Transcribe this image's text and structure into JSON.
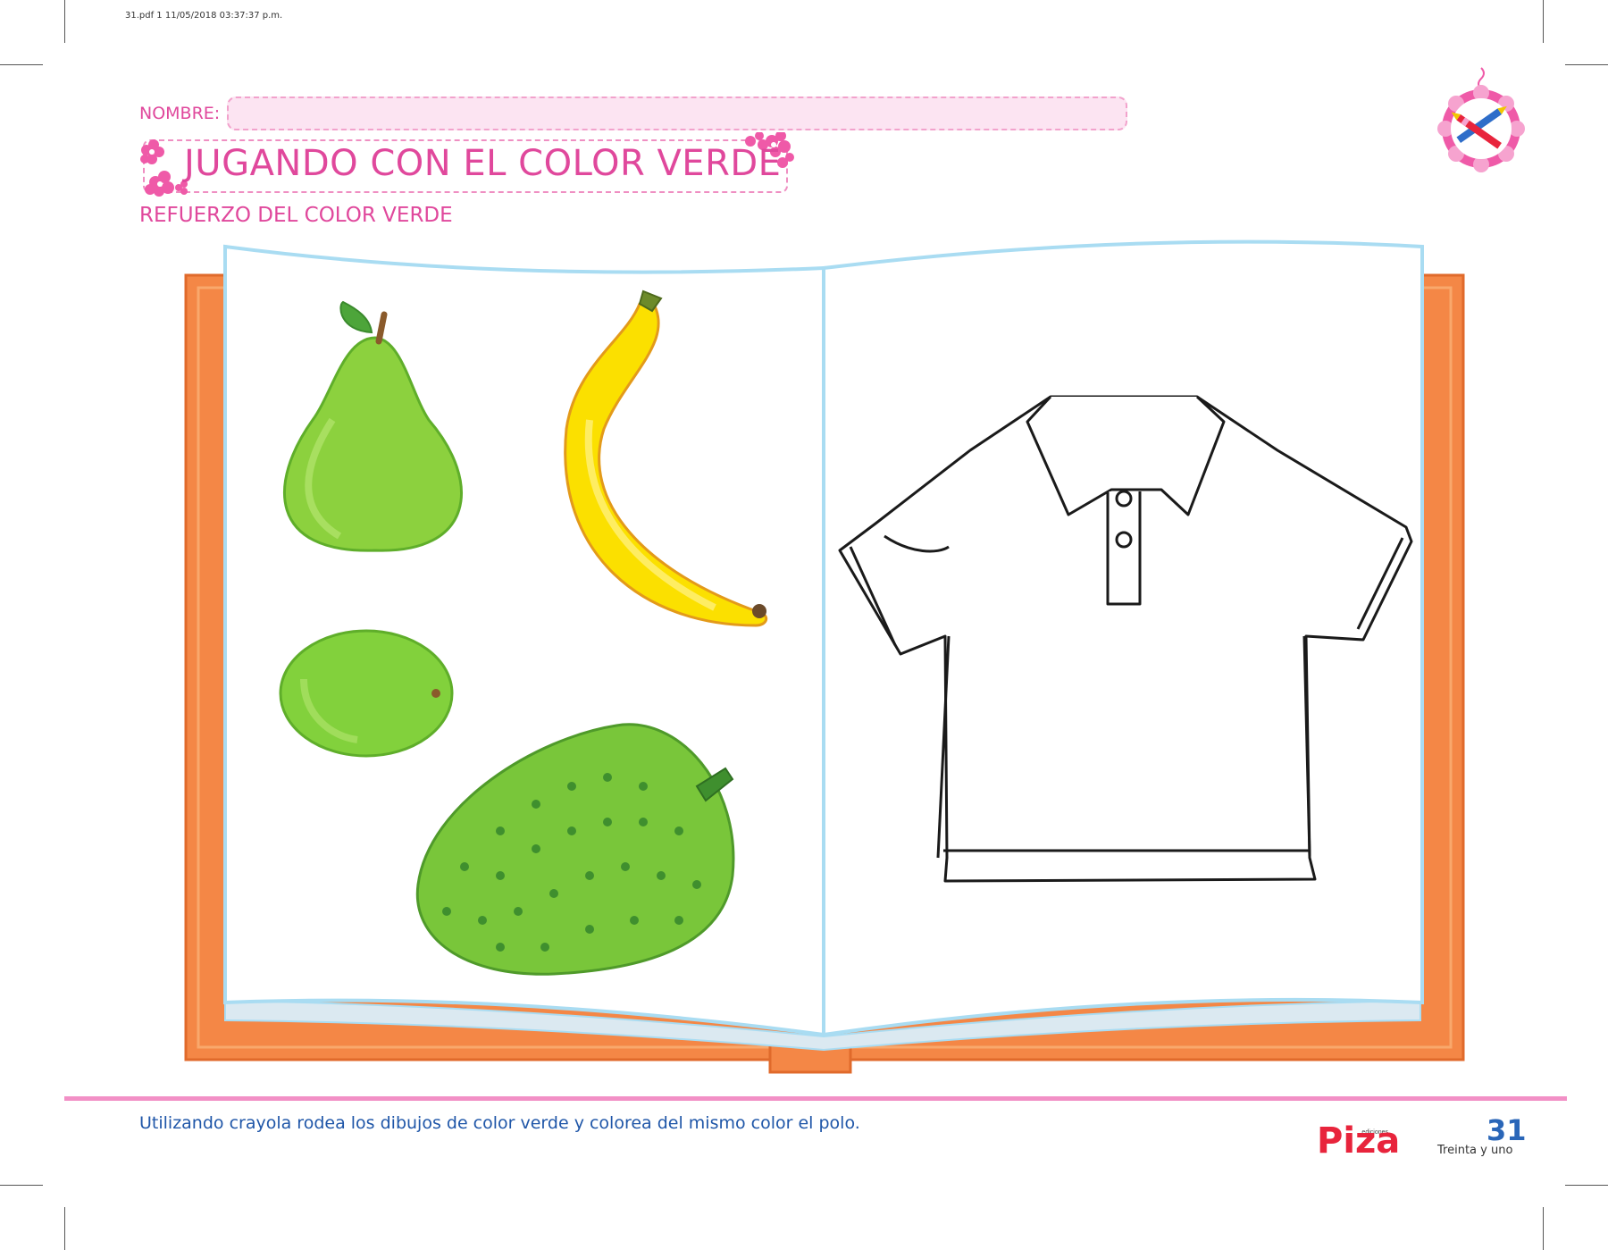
{
  "print_info": "31.pdf   1   11/05/2018   03:37:37 p.m.",
  "header": {
    "name_label": "NOMBRE:",
    "title": "JUGANDO CON EL COLOR VERDE",
    "subtitle": "REFUERZO DEL COLOR VERDE"
  },
  "book": {
    "left_page_items": [
      {
        "name": "pear",
        "color": "#8cd13e"
      },
      {
        "name": "banana",
        "color": "#fbe000"
      },
      {
        "name": "lime",
        "color": "#82d13c"
      },
      {
        "name": "soursop",
        "color": "#79c63a"
      }
    ],
    "right_page_items": [
      {
        "name": "polo-shirt-outline",
        "color": "#000000"
      }
    ],
    "cover_color": "#f48746",
    "page_border_color": "#a9dcf2"
  },
  "footer": {
    "instruction": "Utilizando crayola rodea los dibujos de color verde y colorea del mismo color el polo.",
    "logo": "Piza",
    "logo_small": "ediciones",
    "page_number": "31",
    "page_words": "Treinta y uno"
  },
  "colors": {
    "accent_pink": "#e0489c",
    "accent_blue": "#1f56a8",
    "logo_red": "#e8243c"
  }
}
